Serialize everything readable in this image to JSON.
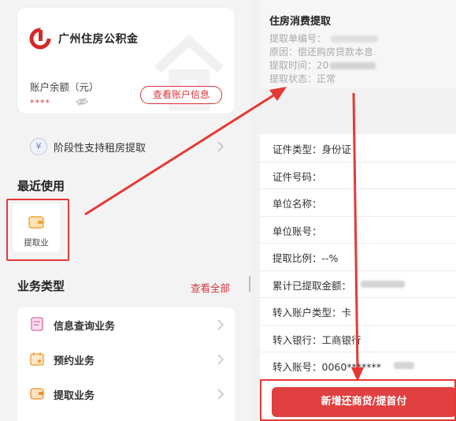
{
  "account_card": {
    "brand": "广州住房公积金",
    "balance_label": "账户余额（元）",
    "balance_masked": "****",
    "view_account_label": "查看账户信息"
  },
  "stage_item": {
    "icon": "¥",
    "label": "阶段性支持租房提取"
  },
  "recent": {
    "title": "最近使用",
    "tile_label": "提取业"
  },
  "business": {
    "title": "业务类型",
    "view_all": "查看全部",
    "items": [
      {
        "label": "信息查询业务",
        "icon": "info-query-icon"
      },
      {
        "label": "预约业务",
        "icon": "calendar-icon"
      },
      {
        "label": "提取业务",
        "icon": "wallet-icon"
      }
    ]
  },
  "withdraw_summary": {
    "title": "住房消费提取",
    "lines": [
      "提取单编号：",
      "原因：偿还购房贷款本息",
      "提取时间：20",
      "提取状态：正常"
    ]
  },
  "detail_rows": [
    "证件类型：身份证",
    "证件号码：",
    "单位名称：",
    "单位账号：",
    "提取比例：--%",
    "累计已提取金额：",
    "转入账户类型：卡",
    "转入银行：工商银行",
    "转入账号：0060*******"
  ],
  "cta_label": "新增还商贷/提首付",
  "colors": {
    "accent": "#e04040",
    "annotation": "#e53935"
  }
}
